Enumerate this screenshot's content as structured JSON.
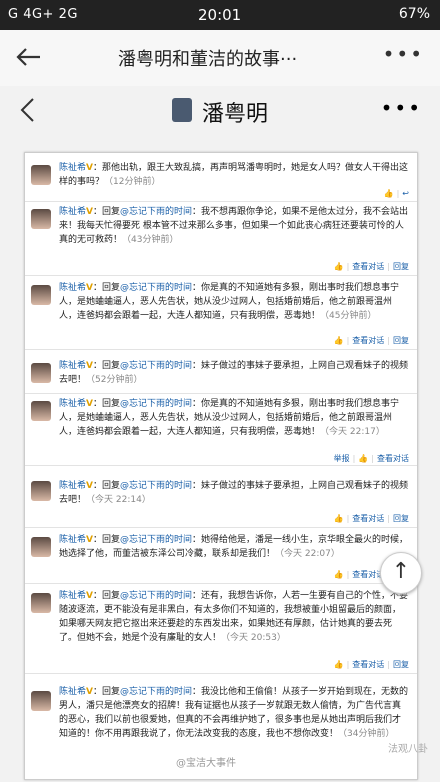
{
  "status": {
    "carrier": "G 4G+ 2G",
    "time": "20:01",
    "battery": "67%"
  },
  "appbar": {
    "title": "潘粤明和董洁的故事···",
    "more": "•••"
  },
  "inner": {
    "name": "潘粤明",
    "more": "•••"
  },
  "entries": [
    {
      "author": "陈祉希",
      "text": "：那他出轨，跟王大致乱搞，再声明骂潘粤明时，她是女人吗？做女人干得出这样的事吗？",
      "ago": "（12分钟前）",
      "a1": "",
      "a2": ""
    },
    {
      "author": "陈祉希",
      "reply": "回复",
      "link": "@忘记下雨的时间",
      "text": "：我不想再跟你争论，如果不是他太过分，我不会站出来！我每天忙得要死 根本管不过来那么多事，但如果一个如此丧心病狂还要装可怜的人真的无可救药！",
      "ago": "（43分钟前）",
      "a1": "查看对话",
      "a2": "回复"
    },
    {
      "author": "陈祉希",
      "reply": "回复",
      "link": "@忘记下雨的时间",
      "text": "：你是真的不知道她有多狠，刚出事时我们想息事宁人，是她蛐蛐逼人，恶人先告状，她从没少过网人，包括婚前婚后，他之前跟哥温州人，连爸妈都会跟着一起，大连人都知道，只有我明偿，恶毒她！",
      "ago": "（45分钟前）",
      "a1": "查看对话",
      "a2": "回复"
    },
    {
      "author": "陈祉希",
      "reply": "回复",
      "link": "@忘记下雨的时间",
      "text": "：妹子做过的事妹子要承担，上网自己观看妹子的视频去吧！",
      "ago": "（52分钟前）",
      "a1": "",
      "a2": ""
    },
    {
      "author": "陈祉希",
      "reply": "回复",
      "link": "@忘记下雨的时间",
      "text": "：你是真的不知道她有多狠，刚出事时我们想息事宁人，是她蛐蛐逼人，恶人先告状，她从没少过网人，包括婚前婚后，他之前跟哥温州人，连爸妈都会跟着一起，大连人都知道，只有我明偿，恶毒她！",
      "ago": "（今天 22:17）",
      "a1": "举报",
      "a2": "查看对话"
    },
    {
      "author": "陈祉希",
      "reply": "回复",
      "link": "@忘记下雨的时间",
      "text": "：妹子做过的事妹子要承担，上网自己观看妹子的视频去吧！",
      "ago": "（今天 22:14）",
      "a1": "查看对话",
      "a2": "回复"
    },
    {
      "author": "陈祉希",
      "reply": "回复",
      "link": "@忘记下雨的时间",
      "text": "：她得给他是，潘是一线小生，京华眼全最火的时候，她选择了他，而董洁被东泽公司冷藏，联系却是我们！",
      "ago": "（今天 22:07）",
      "a1": "查看对话",
      "a2": "回复"
    },
    {
      "author": "陈祉希",
      "reply": "回复",
      "link": "@忘记下雨的时间",
      "text": "：还有，我想告诉你，人若一生要有自己的个性，不要随波逐流，更不能没有是非黑白，有太多你们不知道的，我想被董小姐留最后的颜面，如果哪天网友把它抠出来还要趁的东西发出来，如果她还有厚颜，估计她真的要去死了。但她不会，她是个没有廉耻的女人！",
      "ago": "（今天 20:53）",
      "a1": "查看对话",
      "a2": "回复"
    },
    {
      "author": "陈祉希",
      "reply": "回复",
      "link": "@忘记下雨的时间",
      "text": "：我没比他和王偷偷！从孩子一岁开始到现在，无数的男人，潘只是他漂亮女的招牌！我有证据也从孩子一岁就跟无数人偷情，为广告代言真的恶心，我们以前也很爱她，但真的不会再维护她了，很多事也是从她出声明后我们才知道的！你不用再跟我说了，你无法改变我的态度，我也不想你改变！",
      "ago": "（34分钟前）",
      "a1": "查看对话",
      "a2": "回复"
    }
  ],
  "watermark": {
    "text": "@宝洁大事件",
    "badge": "法观八卦"
  }
}
